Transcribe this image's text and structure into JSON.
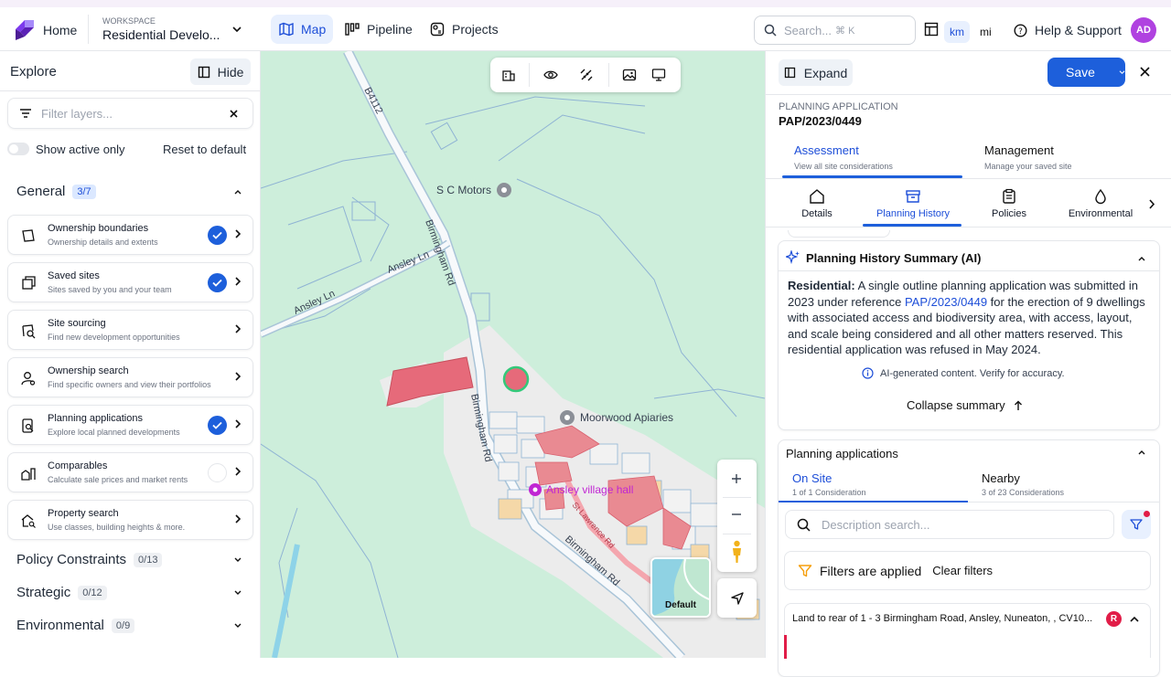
{
  "header": {
    "home_label": "Home",
    "workspace_caption": "WORKSPACE",
    "workspace_name": "Residential Develo...",
    "nav": {
      "map": "Map",
      "pipeline": "Pipeline",
      "projects": "Projects"
    },
    "search_placeholder": "Search...",
    "search_shortcut": "⌘ K",
    "unit_km": "km",
    "unit_mi": "mi",
    "help_label": "Help & Support",
    "avatar_initials": "AD"
  },
  "explore": {
    "title": "Explore",
    "hide_label": "Hide",
    "filter_placeholder": "Filter layers...",
    "show_active_label": "Show active only",
    "reset_label": "Reset to default",
    "general": {
      "title": "General",
      "count": "3/7"
    },
    "layers": [
      {
        "title": "Ownership boundaries",
        "subtitle": "Ownership details and extents",
        "checked": true
      },
      {
        "title": "Saved sites",
        "subtitle": "Sites saved by you and your team",
        "checked": true
      },
      {
        "title": "Site sourcing",
        "subtitle": "Find new development opportunities"
      },
      {
        "title": "Ownership search",
        "subtitle": "Find specific owners and view their portfolios"
      },
      {
        "title": "Planning applications",
        "subtitle": "Explore local planned developments",
        "checked": true
      },
      {
        "title": "Comparables",
        "subtitle": "Calculate sale prices and market rents",
        "checked": false
      },
      {
        "title": "Property search",
        "subtitle": "Use classes, building heights & more."
      }
    ],
    "sections": [
      {
        "title": "Policy Constraints",
        "count": "0/13"
      },
      {
        "title": "Strategic",
        "count": "0/12"
      },
      {
        "title": "Environmental",
        "count": "0/9"
      }
    ]
  },
  "map": {
    "labels": {
      "road_b4112": "B4112",
      "birmingham_rd_1": "Birmingham Rd",
      "birmingham_rd_2": "Birmingham Rd",
      "birmingham_rd_3": "Birmingham Rd",
      "ansley_ln_1": "Ansley Ln",
      "ansley_ln_2": "Ansley Ln",
      "st_lawrence": "St Lawrence Rd",
      "poi_sc_motors": "S C Motors",
      "poi_moorwood": "Moorwood Apiaries",
      "poi_village_hall": "Ansley village hall"
    },
    "basemap_label": "Default",
    "colors": {
      "land": "#cdeedb",
      "road": "#a9c4d8",
      "parcel": "#e98a92",
      "selected": "#e66a7a",
      "selected_ring": "#33c97a"
    }
  },
  "panel": {
    "expand_label": "Expand",
    "save_label": "Save",
    "kicker": "PLANNING APPLICATION",
    "ref": "PAP/2023/0449",
    "tabs": [
      {
        "label": "Assessment",
        "sub": "View all site considerations",
        "active": true
      },
      {
        "label": "Management",
        "sub": "Manage your saved site"
      }
    ],
    "icon_tabs": [
      "Details",
      "Planning History",
      "Policies",
      "Environmental"
    ],
    "summary": {
      "title": "Planning History Summary (AI)",
      "lead": "Residential:",
      "text_1": " A single outline planning application was submitted in 2023 under reference ",
      "link": "PAP/2023/0449",
      "text_2": " for the erection of 9 dwellings with associated access and biodiversity area, with access, layout, and scale being considered and all other matters reserved. This residential application was refused in May 2024.",
      "disclaimer": "AI-generated content. Verify for accuracy.",
      "collapse_label": "Collapse summary"
    },
    "applications": {
      "title": "Planning applications",
      "tabs": [
        {
          "label": "On Site",
          "sub": "1 of 1 Consideration",
          "active": true
        },
        {
          "label": "Nearby",
          "sub": "3 of 23 Considerations"
        }
      ],
      "search_placeholder": "Description search...",
      "filters_label": "Filters are applied",
      "clear_label": "Clear filters",
      "row_title": "Land to rear of  1 - 3 Birmingham Road, Ansley, Nuneaton, , CV10...",
      "row_status": "R"
    },
    "accent": "#1d5fdb"
  }
}
